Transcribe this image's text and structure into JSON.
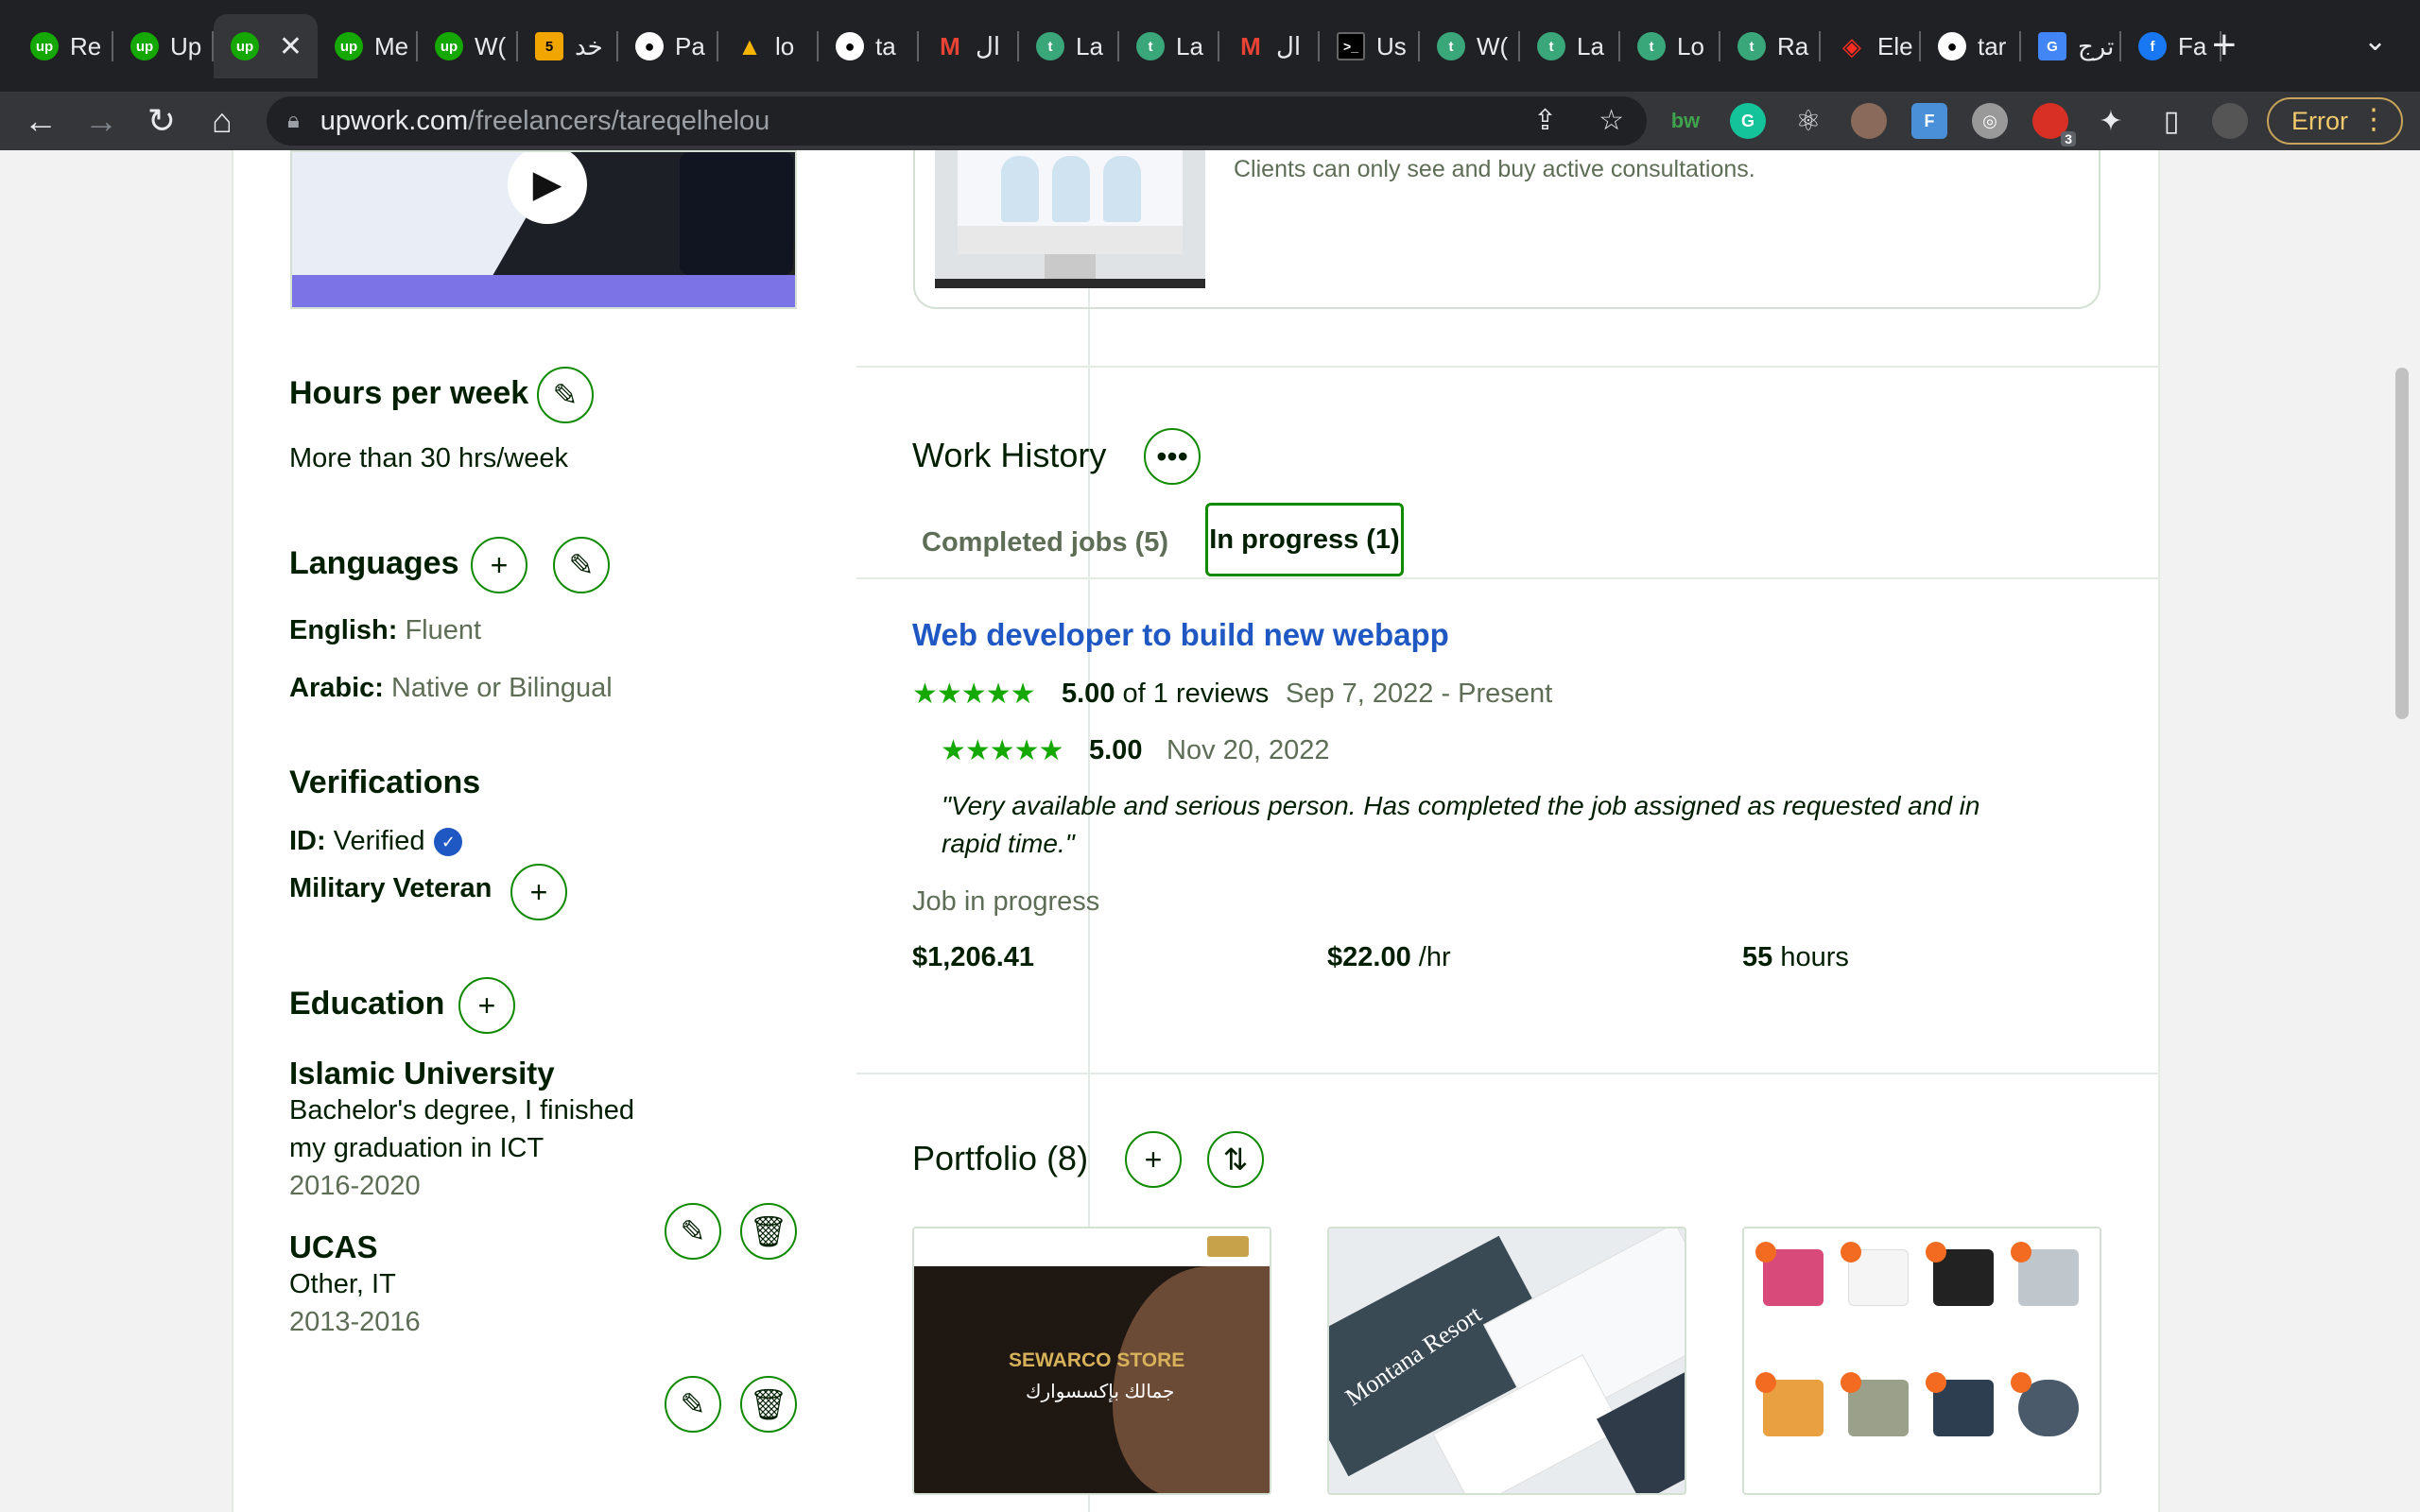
{
  "browser": {
    "tabs": [
      {
        "icon": "upwork-icon",
        "label": "Re"
      },
      {
        "icon": "upwork-icon",
        "label": "Up"
      },
      {
        "icon": "upwork-icon",
        "label": "",
        "active": true
      },
      {
        "icon": "upwork-icon",
        "label": "Me"
      },
      {
        "icon": "upwork-icon",
        "label": "W("
      },
      {
        "icon": "five-icon",
        "label": "خد"
      },
      {
        "icon": "github-icon",
        "label": "Pa"
      },
      {
        "icon": "triangle-icon",
        "label": "lo"
      },
      {
        "icon": "github-icon",
        "label": "ta"
      },
      {
        "icon": "gmail-icon",
        "label": "ال"
      },
      {
        "icon": "t-icon",
        "label": "La"
      },
      {
        "icon": "t-icon",
        "label": "La"
      },
      {
        "icon": "gmail-icon",
        "label": "ال"
      },
      {
        "icon": "terminal-icon",
        "label": "Us"
      },
      {
        "icon": "t-icon",
        "label": "W("
      },
      {
        "icon": "t-icon",
        "label": "La"
      },
      {
        "icon": "t-icon",
        "label": "Lo"
      },
      {
        "icon": "t-icon",
        "label": "Ra"
      },
      {
        "icon": "laravel-icon",
        "label": "Ele"
      },
      {
        "icon": "github-icon",
        "label": "tar"
      },
      {
        "icon": "translate-icon",
        "label": "ترج"
      },
      {
        "icon": "facebook-icon",
        "label": "Fa"
      }
    ],
    "url_host": "upwork.com",
    "url_path": "/freelancers/tareqelhelou",
    "error_label": "Error",
    "extension_badge": "3"
  },
  "left": {
    "hours": {
      "title": "Hours per week",
      "value": "More than 30 hrs/week"
    },
    "languages": {
      "title": "Languages",
      "items": [
        {
          "name": "English:",
          "level": "Fluent"
        },
        {
          "name": "Arabic:",
          "level": "Native or Bilingual"
        }
      ]
    },
    "verifications": {
      "title": "Verifications",
      "id_label": "ID:",
      "id_value": "Verified",
      "military": "Military Veteran"
    },
    "education": {
      "title": "Education",
      "items": [
        {
          "school": "Islamic University",
          "degree_line1": "Bachelor's degree, I finished",
          "degree_line2": "my graduation in ICT",
          "years": "2016-2020"
        },
        {
          "school": "UCAS",
          "degree_line1": "Other, IT",
          "degree_line2": "",
          "years": "2013-2016"
        }
      ]
    }
  },
  "right": {
    "consultation_note": "Clients can only see and buy active consultations.",
    "work_history": {
      "title": "Work History",
      "tabs": {
        "completed": "Completed jobs (5)",
        "in_progress": "In progress (1)"
      },
      "job": {
        "title": "Web developer to build new webapp",
        "rating": "5.00",
        "reviews": "of 1 reviews",
        "dates": "Sep 7, 2022 - Present",
        "client_rating": "5.00",
        "client_date": "Nov 20, 2022",
        "quote_line1": "\"Very available and serious person. Has completed the job assigned as requested and in",
        "quote_line2": "rapid time.\"",
        "status": "Job in progress",
        "earned": "$1,206.41",
        "rate": "$22.00",
        "rate_unit": "/hr",
        "hours": "55",
        "hours_unit": "hours"
      }
    },
    "portfolio": {
      "title": "Portfolio (8)",
      "items": [
        {
          "brand": "SEWARCO STORE",
          "arabic": "جمالك بإكسسوارك"
        },
        {
          "label": "Montana Resort"
        },
        {
          "label": ""
        }
      ]
    }
  },
  "colors": {
    "accent": "#108a00",
    "link": "#1f57c3",
    "star": "#14a800",
    "text": "#001e00",
    "muted": "#5e6d55"
  }
}
